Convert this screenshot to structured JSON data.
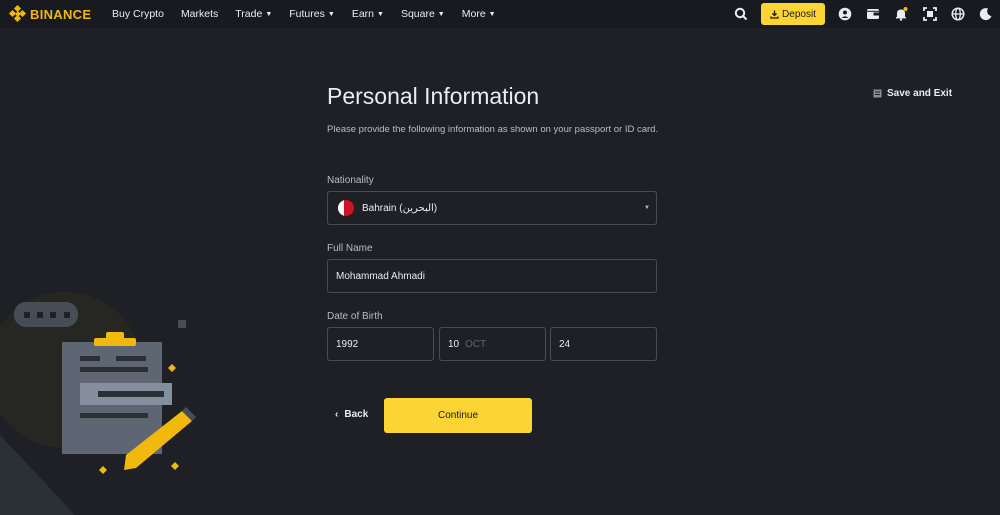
{
  "header": {
    "brand": "BINANCE",
    "nav": [
      {
        "label": "Buy Crypto",
        "dropdown": false
      },
      {
        "label": "Markets",
        "dropdown": false
      },
      {
        "label": "Trade",
        "dropdown": true
      },
      {
        "label": "Futures",
        "dropdown": true
      },
      {
        "label": "Earn",
        "dropdown": true
      },
      {
        "label": "Square",
        "dropdown": true
      },
      {
        "label": "More",
        "dropdown": true
      }
    ],
    "deposit_label": "Deposit",
    "icons": [
      "search-icon",
      "download-icon",
      "user-icon",
      "wallet-icon",
      "bell-icon",
      "qr-scan-icon",
      "globe-icon",
      "moon-icon"
    ]
  },
  "form": {
    "title": "Personal Information",
    "save_exit": "Save and Exit",
    "description": "Please provide the following information as shown on your passport or ID card.",
    "nationality": {
      "label": "Nationality",
      "value": "Bahrain (البحرين)"
    },
    "full_name": {
      "label": "Full Name",
      "value": "Mohammad Ahmadi"
    },
    "dob": {
      "label": "Date of Birth",
      "year": "1992",
      "month_num": "10",
      "month_name": "OCT",
      "day": "24"
    },
    "back_label": "Back",
    "continue_label": "Continue"
  },
  "colors": {
    "brand": "#f0b90b",
    "button": "#fcd535",
    "background": "#1e2026",
    "header_bg": "#181a20",
    "border": "#474d57"
  }
}
